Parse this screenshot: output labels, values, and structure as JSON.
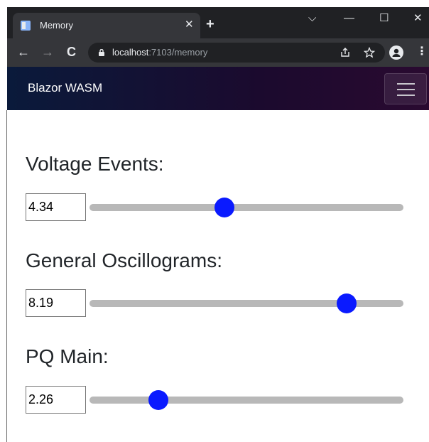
{
  "browser": {
    "tab_title": "Memory",
    "tab_close": "✕",
    "new_tab": "+",
    "url_host": "localhost",
    "url_rest": ":7103/memory",
    "window_controls": {
      "dropdown": "⌵",
      "minimize": "—",
      "maximize": "☐",
      "close": "✕"
    },
    "nav": {
      "back": "←",
      "forward": "→",
      "reload": "C"
    },
    "icons": [
      "favicon-icon",
      "lock-icon",
      "share-icon",
      "star-icon",
      "profile-icon",
      "menu-dots-icon"
    ]
  },
  "navbar": {
    "brand": "Blazor WASM",
    "toggler_icon": "hamburger-icon"
  },
  "sliders": [
    {
      "label": "Voltage Events:",
      "value": "4.34",
      "fraction": 0.43
    },
    {
      "label": "General Oscillograms:",
      "value": "8.19",
      "fraction": 0.82
    },
    {
      "label": "PQ Main:",
      "value": "2.26",
      "fraction": 0.22
    }
  ],
  "colors": {
    "thumb": "#0a1aff",
    "track": "#b8b8b8",
    "navbar_start": "#0a1a3b",
    "navbar_end": "#2a0a30"
  }
}
